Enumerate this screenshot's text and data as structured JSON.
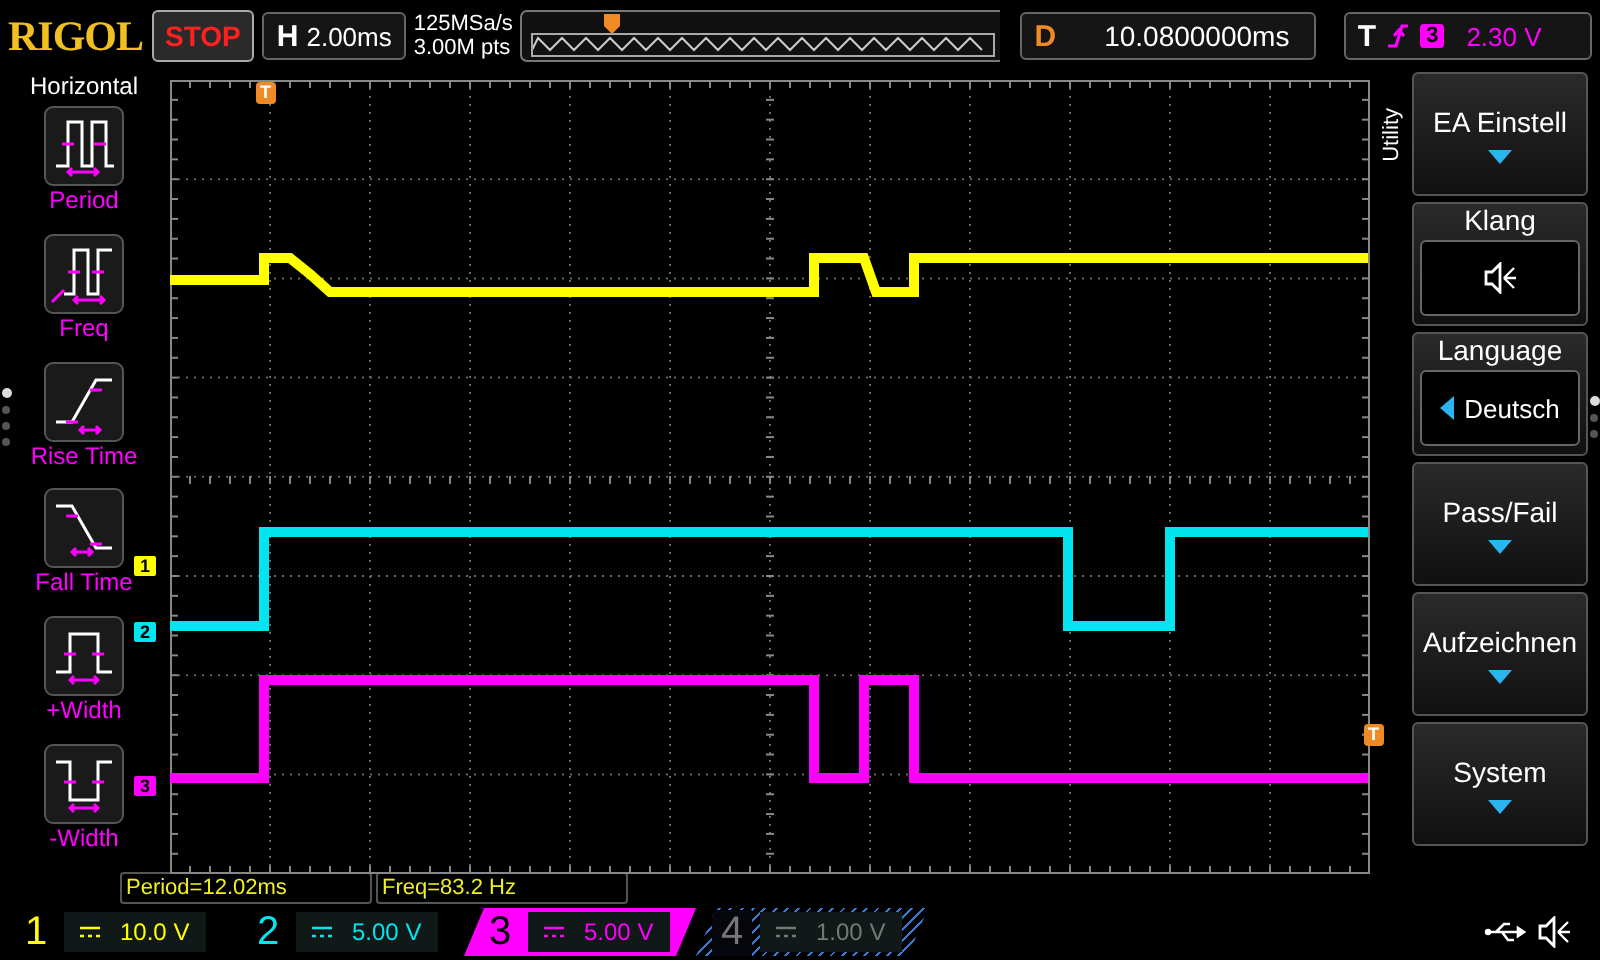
{
  "brand": "RIGOL",
  "run_state": "STOP",
  "horizontal": {
    "label": "H",
    "value": "2.00ms"
  },
  "sample_rate": "125MSa/s",
  "memory_depth": "3.00M pts",
  "delay": {
    "label": "D",
    "value": "10.0800000ms"
  },
  "trigger": {
    "label": "T",
    "source": "3",
    "level": "2.30 V"
  },
  "left_menu": {
    "title": "Horizontal",
    "items": [
      {
        "kind": "period",
        "label": "Period"
      },
      {
        "kind": "freq",
        "label": "Freq"
      },
      {
        "kind": "rise",
        "label": "Rise Time"
      },
      {
        "kind": "fall",
        "label": "Fall Time"
      },
      {
        "kind": "pwidth",
        "label": "+Width"
      },
      {
        "kind": "nwidth",
        "label": "-Width"
      }
    ],
    "pages": [
      {
        "selected": true
      },
      {
        "selected": false
      },
      {
        "selected": false
      },
      {
        "selected": false
      }
    ]
  },
  "screen_markers": {
    "trigger_time": "T",
    "trigger_level": "T",
    "channels": [
      {
        "number": "1",
        "color": "#ffff00"
      },
      {
        "number": "2",
        "color": "#00e5f0"
      },
      {
        "number": "3",
        "color": "#ff00ff"
      }
    ]
  },
  "right_menu": {
    "title": "Utility",
    "items": [
      {
        "kind": "submenu",
        "label": "EA Einstell"
      },
      {
        "kind": "sound",
        "label": "Klang",
        "muted": true
      },
      {
        "kind": "value",
        "label": "Language",
        "value": "Deutsch"
      },
      {
        "kind": "submenu",
        "label": "Pass/Fail"
      },
      {
        "kind": "submenu",
        "label": "Aufzeichnen"
      },
      {
        "kind": "submenu",
        "label": "System"
      }
    ],
    "pages": [
      {
        "selected": true
      },
      {
        "selected": false
      },
      {
        "selected": false
      }
    ]
  },
  "measurements": [
    "Period=12.02ms",
    "Freq=83.2 Hz"
  ],
  "channels": [
    {
      "number": "1",
      "scale": "10.0 V",
      "color": "#ffff00",
      "on": true,
      "selected": false
    },
    {
      "number": "2",
      "scale": "5.00 V",
      "color": "#00e5f0",
      "on": true,
      "selected": false
    },
    {
      "number": "3",
      "scale": "5.00 V",
      "color": "#ff00ff",
      "on": true,
      "selected": true
    },
    {
      "number": "4",
      "scale": "1.00 V",
      "color": "#3a78d0",
      "on": false,
      "selected": false
    }
  ]
}
